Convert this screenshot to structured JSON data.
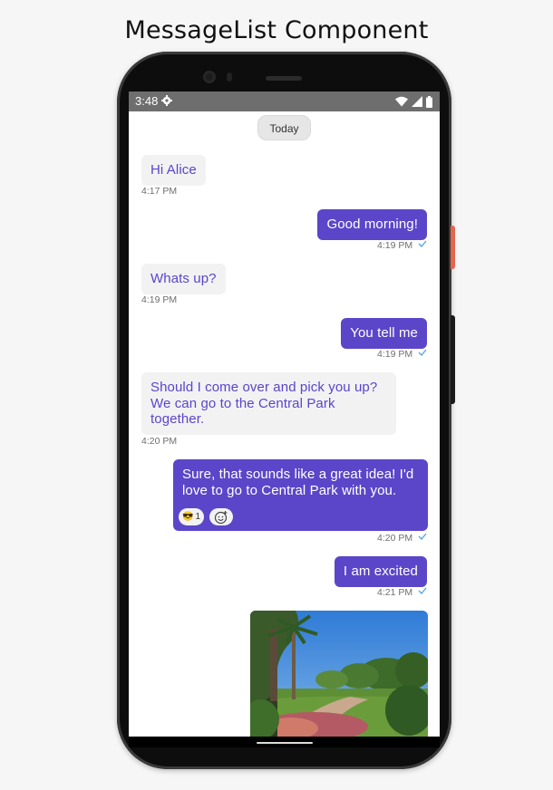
{
  "page_title": "MessageList Component",
  "status_bar": {
    "time": "3:48"
  },
  "date_separator": "Today",
  "messages": [
    {
      "text": "Hi Alice",
      "time": "4:17 PM"
    },
    {
      "text": "Good morning!",
      "time": "4:19 PM"
    },
    {
      "text": "Whats up?",
      "time": "4:19 PM"
    },
    {
      "text": "You tell me",
      "time": "4:19 PM"
    },
    {
      "text": "Should I come over and pick you up? We can go to the Central Park together.",
      "time": "4:20 PM"
    },
    {
      "text": "Sure, that sounds like a great idea! I'd love to go to Central Park with you.",
      "time": "4:20 PM",
      "reactions": [
        {
          "emoji": "😎",
          "count": "1"
        },
        {
          "emoji": "add-reaction-icon"
        }
      ]
    },
    {
      "text": "I am excited",
      "time": "4:21 PM"
    }
  ],
  "colors": {
    "outgoing_bubble": "#5b46c9",
    "incoming_bubble": "#f2f2f2",
    "incoming_text": "#5a45cc",
    "read_check": "#4fa3e8"
  }
}
